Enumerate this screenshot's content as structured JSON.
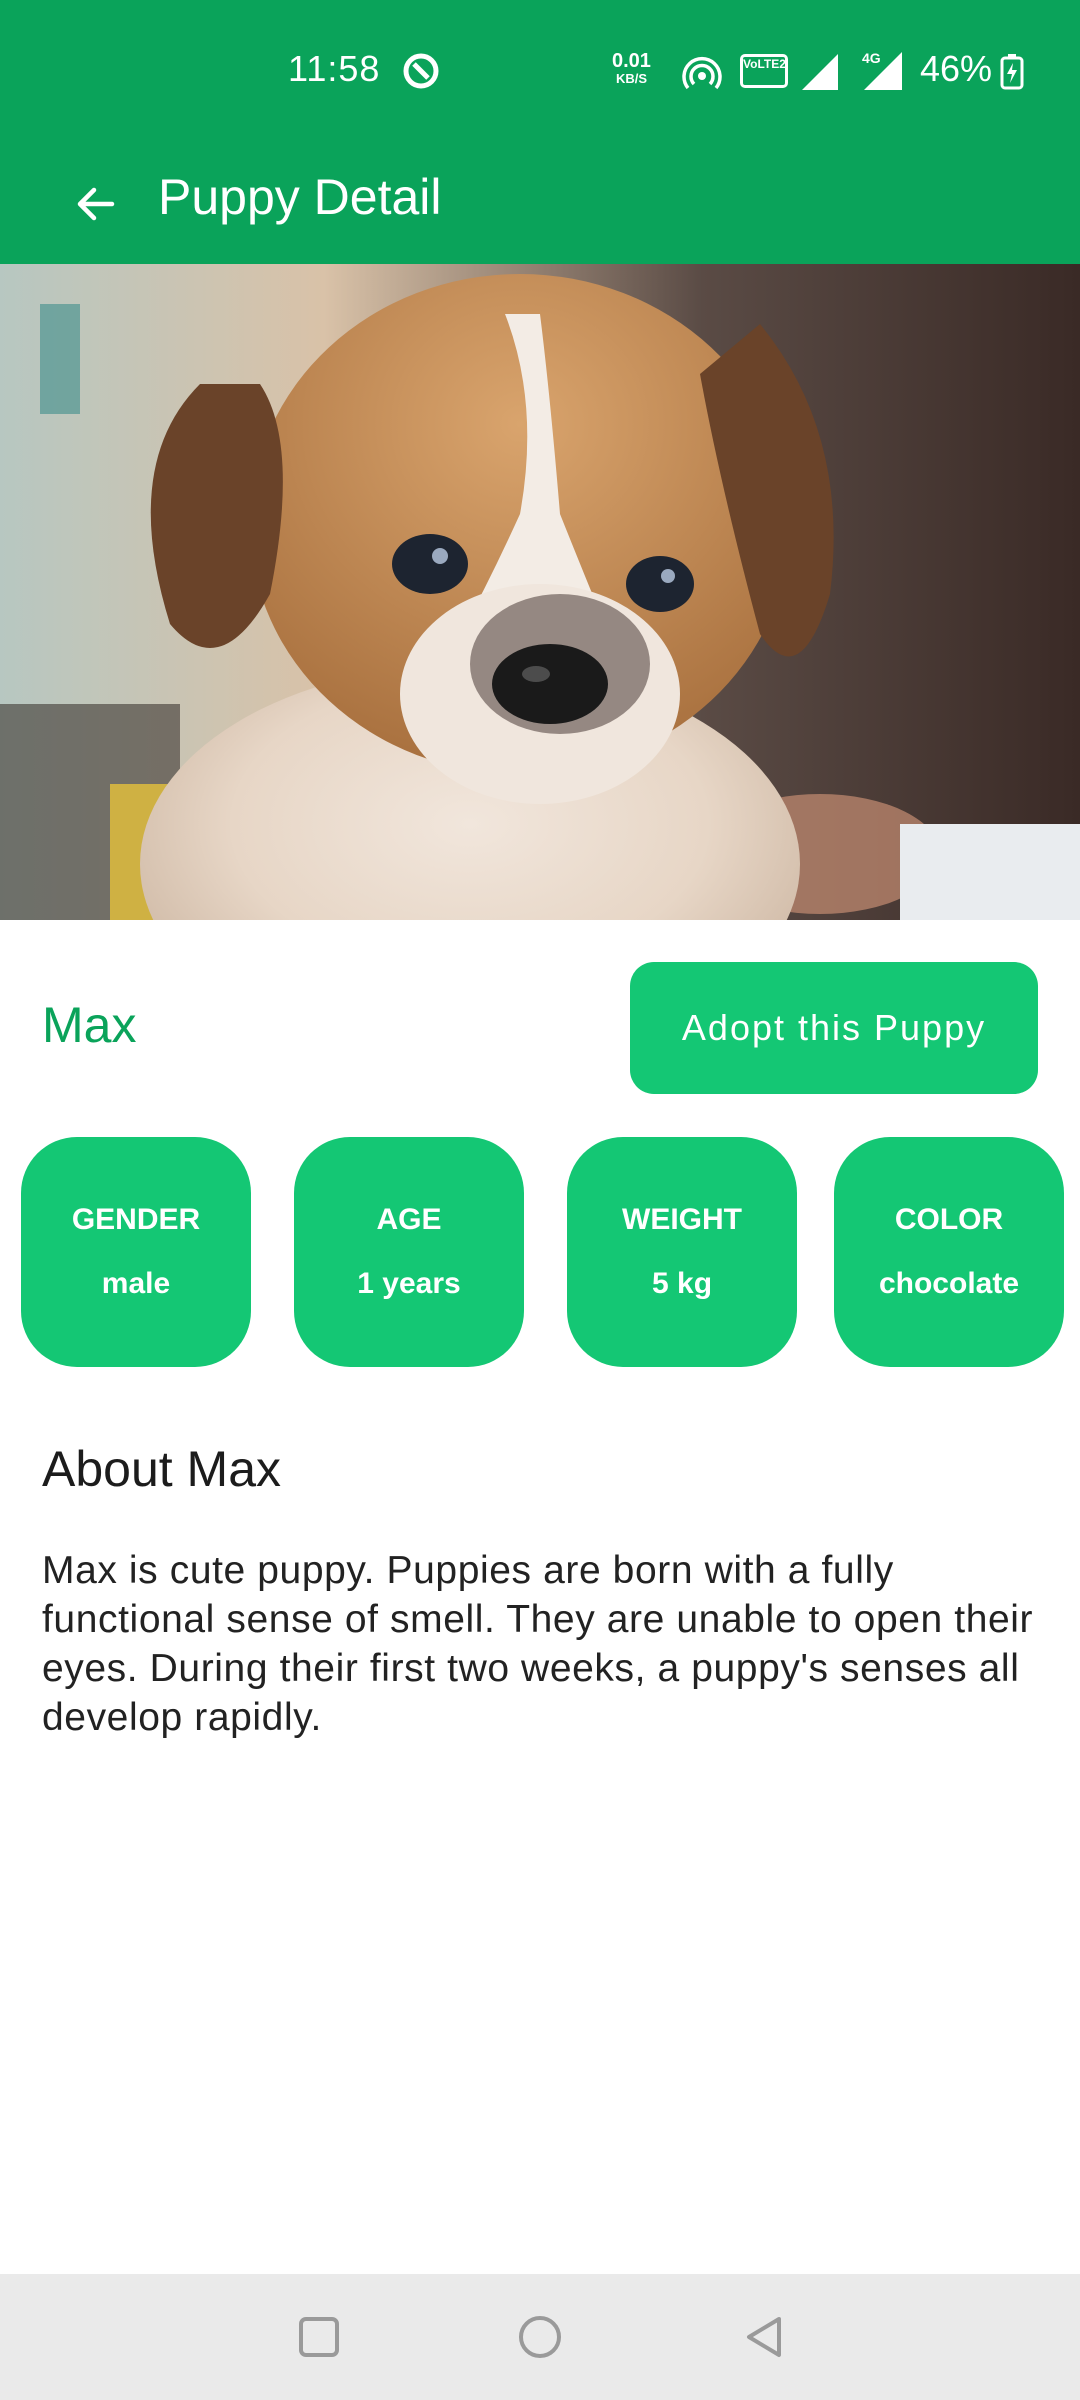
{
  "status_bar": {
    "time": "11:58",
    "net_speed": "0.01",
    "net_speed_unit": "KB/S",
    "volte_label": "VoLTE2",
    "network_type": "4G",
    "battery": "46%"
  },
  "app_bar": {
    "title": "Puppy Detail"
  },
  "puppy": {
    "name": "Max",
    "adopt_button": "Adopt this Puppy",
    "stats": {
      "gender_label": "GENDER",
      "gender_value": "male",
      "age_label": "AGE",
      "age_value": "1 years",
      "weight_label": "WEIGHT",
      "weight_value": "5 kg",
      "color_label": "COLOR",
      "color_value": "chocolate"
    }
  },
  "about": {
    "title": "About Max",
    "body": "Max is cute puppy. Puppies are born with a fully functional sense of smell. They are unable to open their eyes. During their first two weeks, a puppy's senses all develop rapidly."
  },
  "colors": {
    "primary": "#0aa35a",
    "accent": "#14c774"
  },
  "icons": {
    "back": "arrow-left-icon",
    "nav_recents": "square-icon",
    "nav_home": "circle-icon",
    "nav_back": "triangle-back-icon"
  }
}
